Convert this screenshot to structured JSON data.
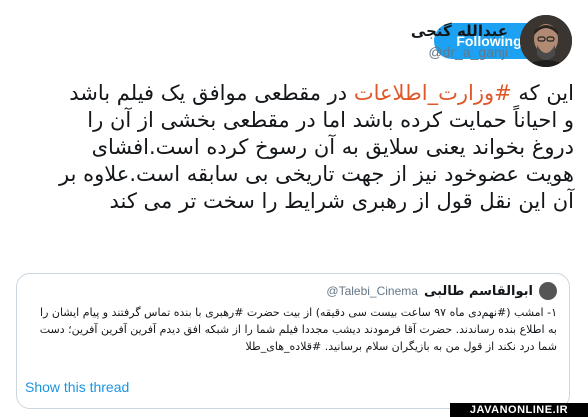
{
  "header": {
    "display_name": "عبدالله گنجی",
    "handle": "@dr_a_ganji",
    "follow_label": "Following",
    "menu_icon": "chevron-down-icon",
    "accent_color": "#1da1f2"
  },
  "tweet": {
    "text_before_hashtag": "این که ",
    "hashtag": "#وزارت_اطلاعات",
    "text_after_hashtag": " در مقطعی موافق یک فیلم باشد و احیاناً حمایت کرده باشد اما در مقطعی بخشی از آن را دروغ بخواند یعنی سلایق به آن رسوخ کرده است.افشای هویت عضوخود نیز از جهت تاریخی بی سابقه است.علاوه بر آن این نقل قول از رهبری شرایط را سخت تر می کند",
    "hashtag_color": "#e0582a"
  },
  "quoted": {
    "display_name": "ابوالقاسم طالبی",
    "handle": "@Talebi_Cinema",
    "text": "۱- امشب (#نهم‌دی ماه ۹۷ ساعت بیست سی دقیقه) از بیت حضرت #رهبری با بنده تماس گرفتند و پیام ایشان را به اطلاع بنده رساندند. حضرت آقا فرمودند دیشب مجددا فیلم شما را از شبکه افق دیدم آفرین آفرین آفرین؛ دست شما درد نکند از قول من به بازیگران سلام برسانید. #قلاده_های_طلا",
    "show_thread_label": "Show this thread"
  },
  "watermark": "JAVANONLINE.IR"
}
